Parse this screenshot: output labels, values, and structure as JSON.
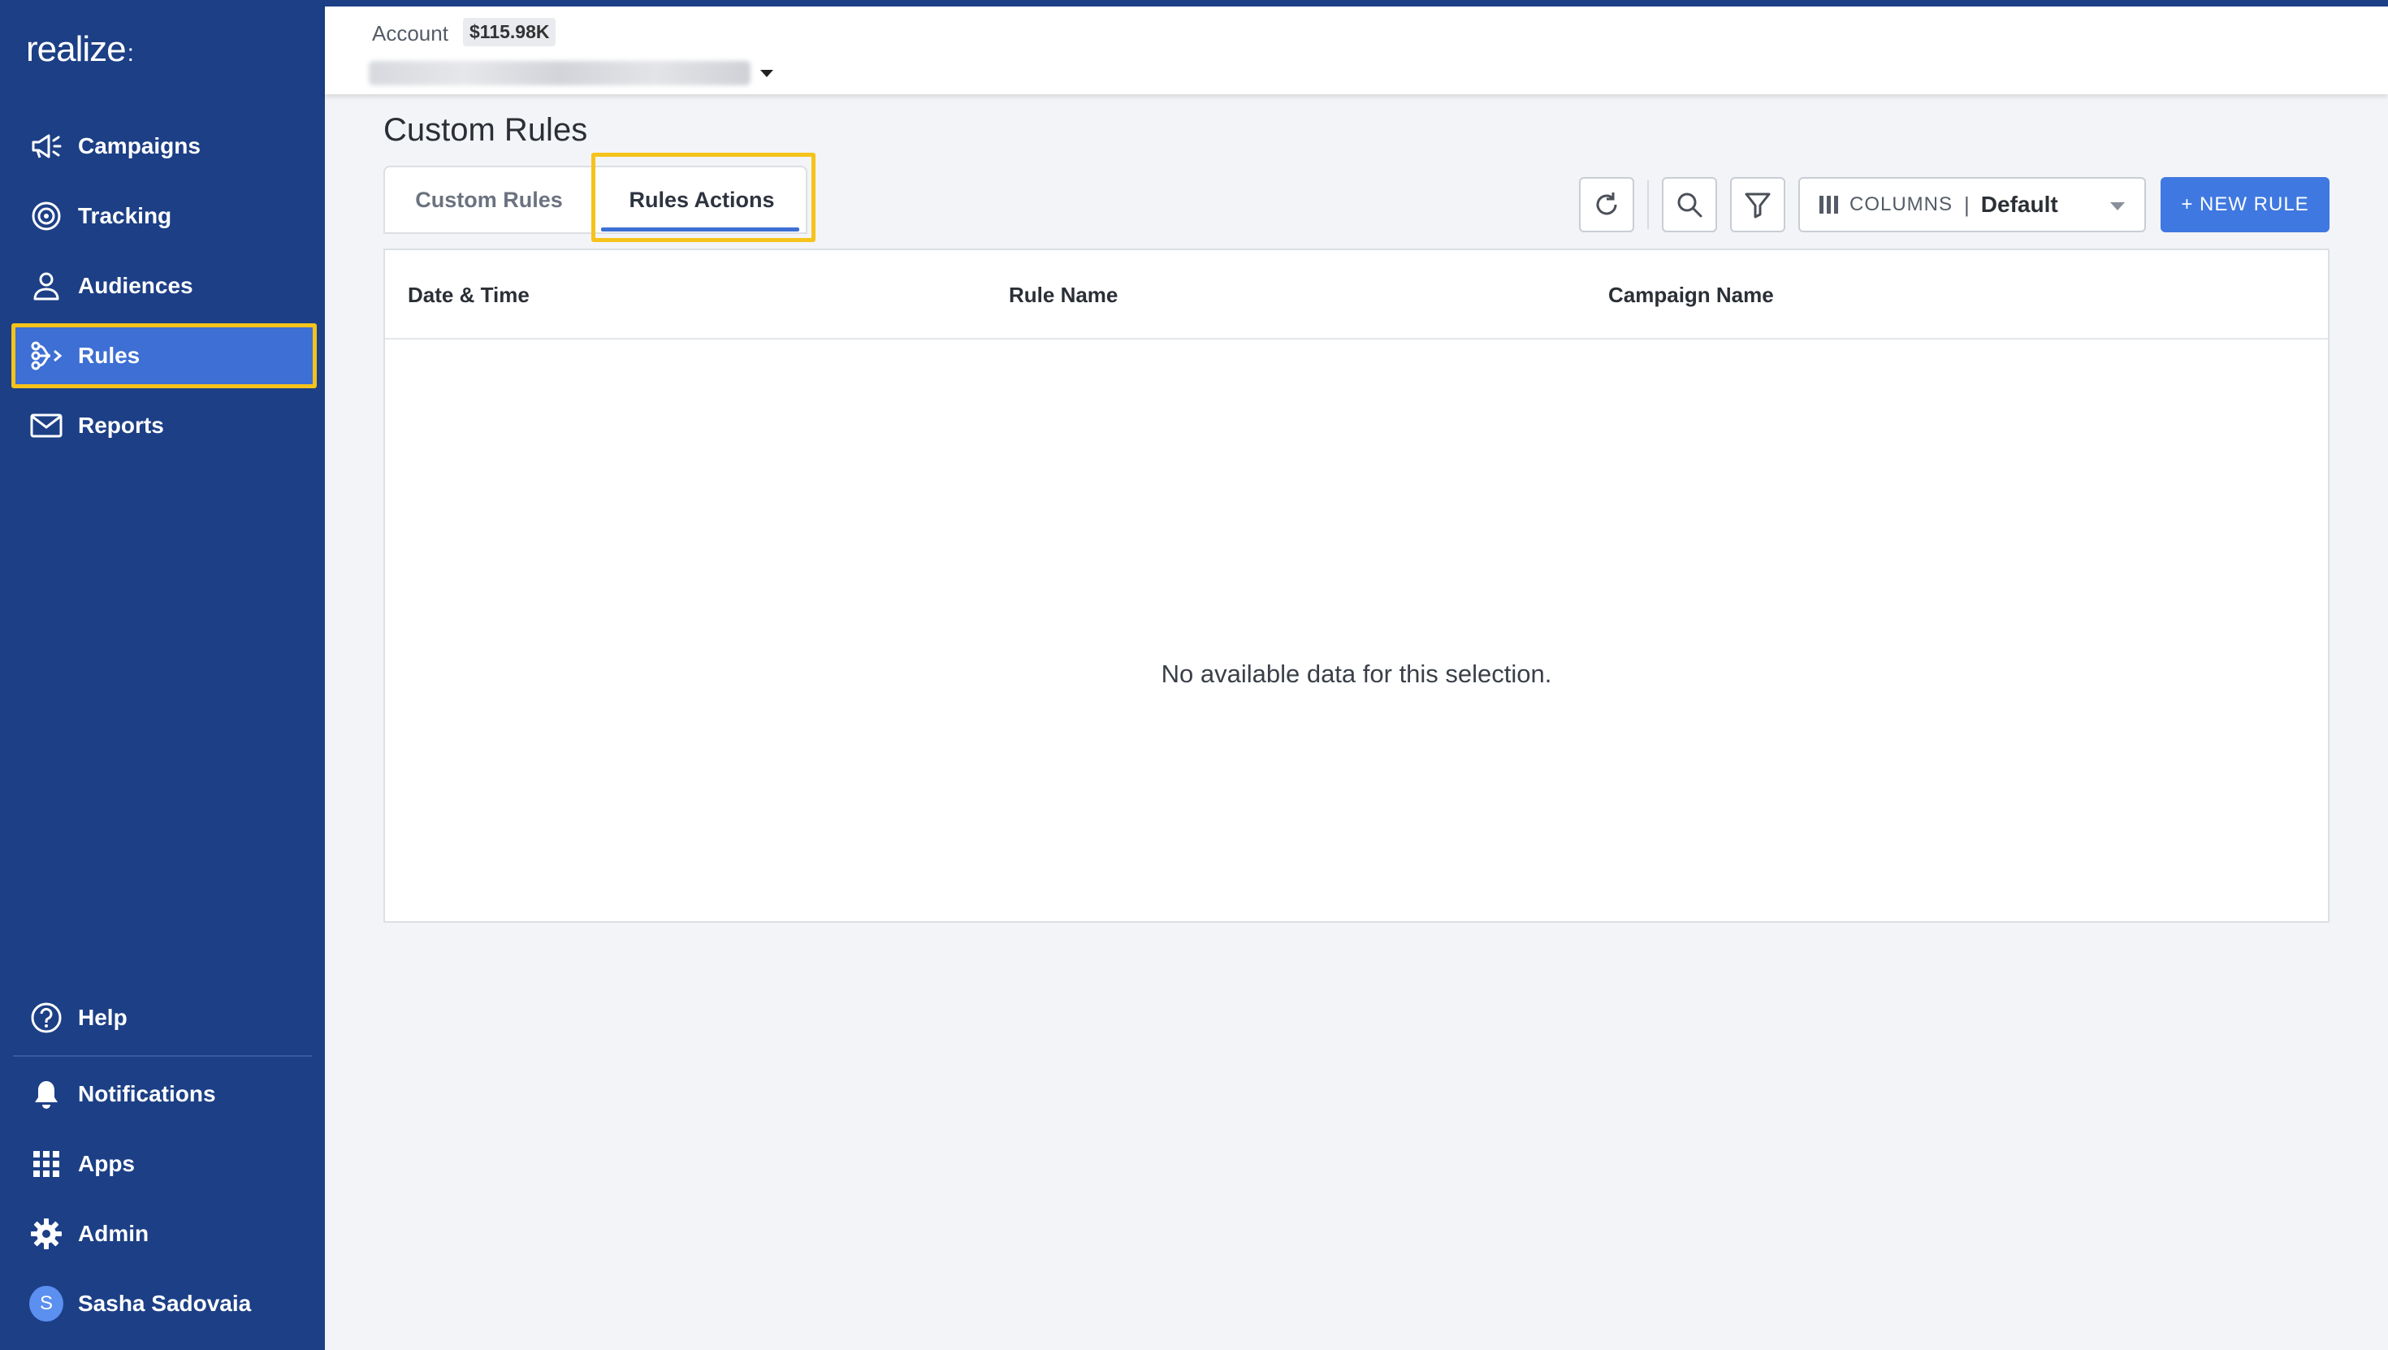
{
  "app": {
    "logo_text": "realize",
    "logo_suffix": ":"
  },
  "sidebar": {
    "items": [
      {
        "label": "Campaigns",
        "icon": "megaphone-icon"
      },
      {
        "label": "Tracking",
        "icon": "target-icon"
      },
      {
        "label": "Audiences",
        "icon": "person-icon"
      },
      {
        "label": "Rules",
        "icon": "rules-flow-icon",
        "active": true
      },
      {
        "label": "Reports",
        "icon": "mail-icon"
      }
    ],
    "bottom": [
      {
        "label": "Help",
        "icon": "help-icon"
      },
      {
        "label": "Notifications",
        "icon": "bell-icon"
      },
      {
        "label": "Apps",
        "icon": "grid-icon"
      },
      {
        "label": "Admin",
        "icon": "gear-icon"
      }
    ],
    "user": {
      "name": "Sasha Sadovaia",
      "initial": "S"
    },
    "colors": {
      "bg": "#1c3f86",
      "active_bg": "#3d6fd4",
      "highlight": "#f5c31a"
    }
  },
  "header": {
    "account_label": "Account",
    "balance": "$115.98K"
  },
  "main": {
    "title": "Custom Rules",
    "tabs": [
      {
        "label": "Custom Rules",
        "active": false
      },
      {
        "label": "Rules Actions",
        "active": true
      }
    ],
    "toolbar": {
      "refresh_icon": "refresh-icon",
      "search_icon": "search-icon",
      "filter_icon": "filter-icon",
      "columns_label": "COLUMNS",
      "columns_separator": "|",
      "columns_value": "Default",
      "new_rule_label": "+ NEW RULE"
    },
    "table": {
      "columns": [
        "Date & Time",
        "Rule Name",
        "Campaign Name"
      ],
      "empty_message": "No available data for this selection."
    }
  }
}
